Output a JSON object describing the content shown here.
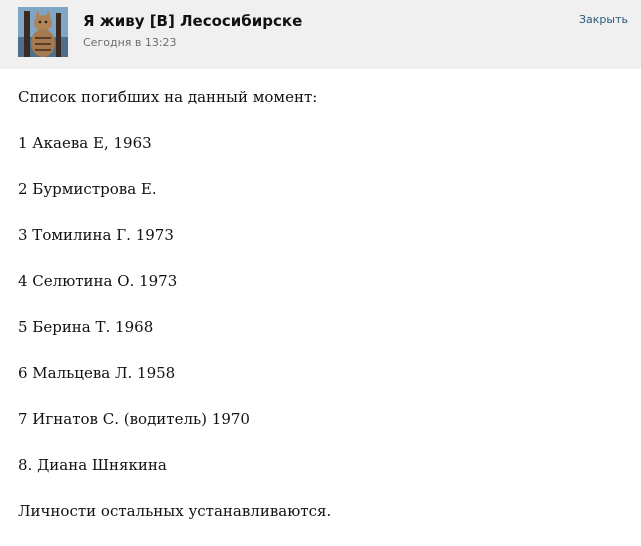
{
  "header": {
    "group_name": "Я живу [В] Лесосибирске",
    "timestamp": "Сегодня в 13:23",
    "close_label": "Закрыть",
    "avatar_icon": "group-avatar-icon"
  },
  "post": {
    "lines": [
      "Список погибших на данный момент:",
      "1 Акаева Е, 1963",
      "2 Бурмистрова Е.",
      "3 Томилина Г. 1973",
      "4 Селютина О. 1973",
      "5 Берина Т. 1968",
      "6 Мальцева Л. 1958",
      "7 Игнатов С. (водитель) 1970",
      "8. Диана Шнякина",
      "Личности остальных устанавливаются."
    ]
  },
  "colors": {
    "header_background": "#f0f0f0",
    "link": "#2b587a",
    "muted_text": "#6d6d6d",
    "body_text": "#111111"
  }
}
